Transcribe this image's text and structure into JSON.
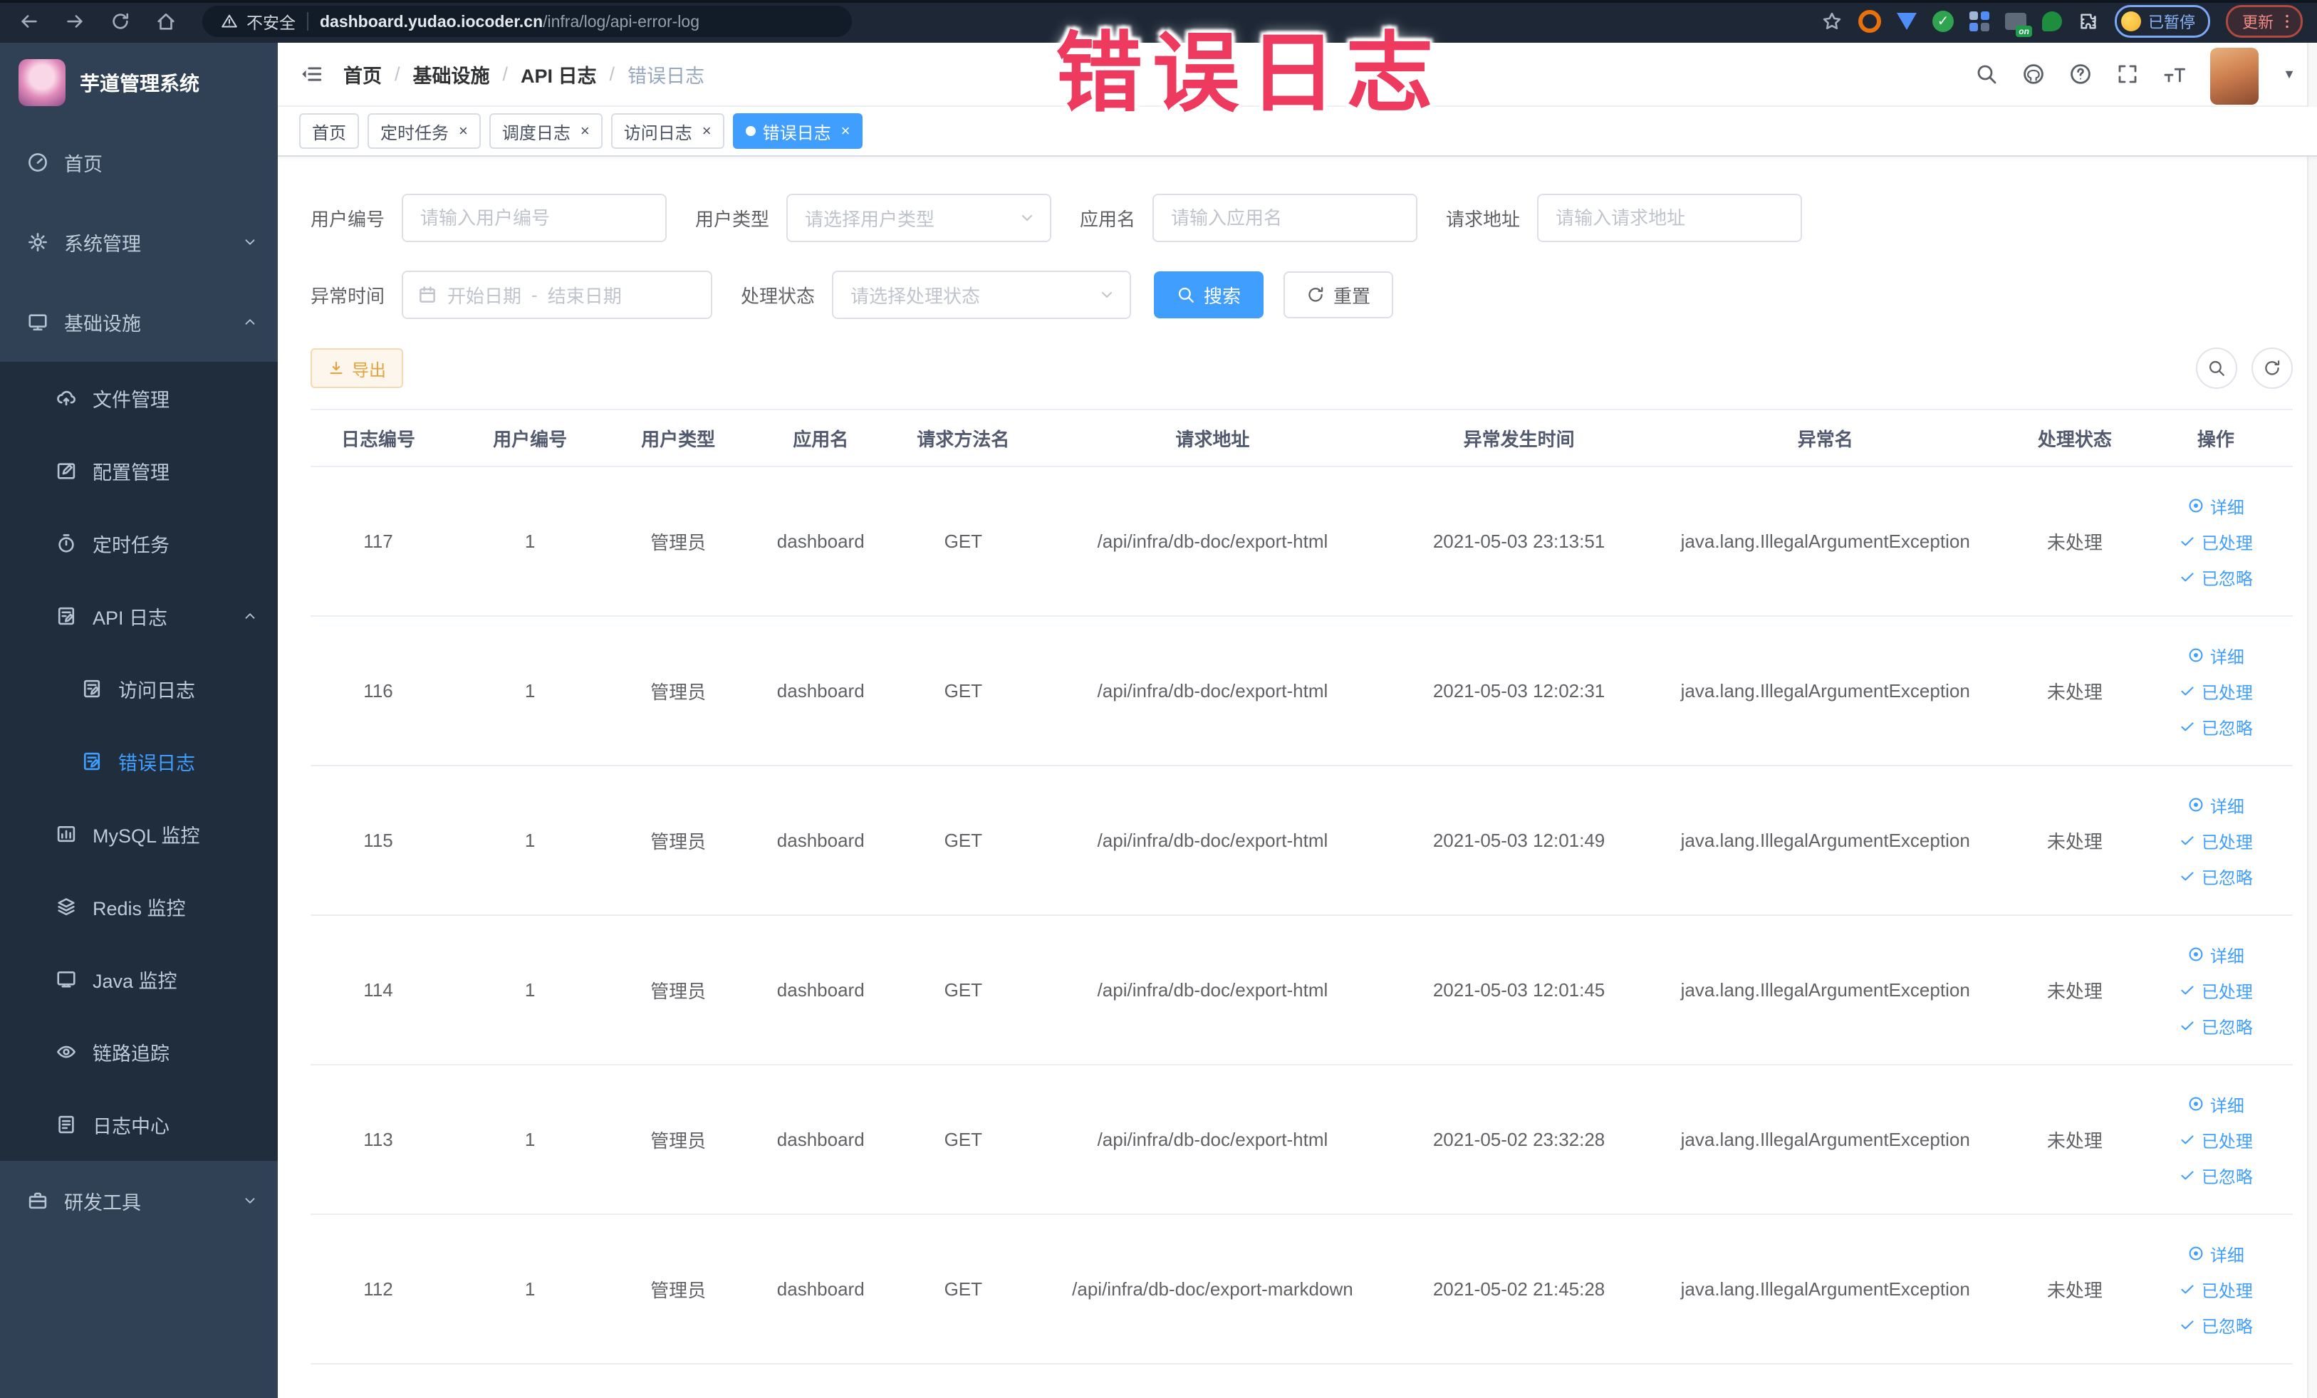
{
  "annotation": {
    "text": "错误日志",
    "color": "#ee3a5f"
  },
  "browser": {
    "security_label": "不安全",
    "url_domain": "dashboard.yudao.iocoder.cn",
    "url_path": "/infra/log/api-error-log",
    "extensions_paused_label": "已暂停",
    "update_label": "更新"
  },
  "sidebar": {
    "title": "芋道管理系统",
    "items": [
      {
        "label": "首页",
        "icon": "gauge",
        "level": 1
      },
      {
        "label": "系统管理",
        "icon": "gear",
        "level": 1,
        "chevron": "down"
      },
      {
        "label": "基础设施",
        "icon": "monitor",
        "level": 1,
        "chevron": "up"
      },
      {
        "label": "文件管理",
        "icon": "cloud",
        "level": 2,
        "sub": true
      },
      {
        "label": "配置管理",
        "icon": "edit",
        "level": 2,
        "sub": true
      },
      {
        "label": "定时任务",
        "icon": "timer",
        "level": 2,
        "sub": true
      },
      {
        "label": "API 日志",
        "icon": "docedit",
        "level": 2,
        "sub": true,
        "chevron": "up"
      },
      {
        "label": "访问日志",
        "icon": "docedit",
        "level": 3,
        "sub": true
      },
      {
        "label": "错误日志",
        "icon": "docedit",
        "level": 3,
        "sub": true,
        "active": true
      },
      {
        "label": "MySQL 监控",
        "icon": "chart",
        "level": 2,
        "sub": true
      },
      {
        "label": "Redis 监控",
        "icon": "layers",
        "level": 2,
        "sub": true
      },
      {
        "label": "Java 监控",
        "icon": "screen",
        "level": 2,
        "sub": true
      },
      {
        "label": "链路追踪",
        "icon": "eye",
        "level": 2,
        "sub": true
      },
      {
        "label": "日志中心",
        "icon": "doc",
        "level": 2,
        "sub": true
      },
      {
        "label": "研发工具",
        "icon": "briefcase",
        "level": 1,
        "chevron": "down"
      }
    ]
  },
  "navbar": {
    "breadcrumb": [
      "首页",
      "基础设施",
      "API 日志",
      "错误日志"
    ]
  },
  "tabs": [
    {
      "label": "首页",
      "closable": false,
      "active": false
    },
    {
      "label": "定时任务",
      "closable": true,
      "active": false
    },
    {
      "label": "调度日志",
      "closable": true,
      "active": false
    },
    {
      "label": "访问日志",
      "closable": true,
      "active": false
    },
    {
      "label": "错误日志",
      "closable": true,
      "active": true
    }
  ],
  "filters": {
    "user_id": {
      "label": "用户编号",
      "placeholder": "请输入用户编号"
    },
    "user_type": {
      "label": "用户类型",
      "placeholder": "请选择用户类型"
    },
    "app_name": {
      "label": "应用名",
      "placeholder": "请输入应用名"
    },
    "request_url": {
      "label": "请求地址",
      "placeholder": "请输入请求地址"
    },
    "exception_time": {
      "label": "异常时间",
      "start_placeholder": "开始日期",
      "separator": "-",
      "end_placeholder": "结束日期"
    },
    "process_status": {
      "label": "处理状态",
      "placeholder": "请选择处理状态"
    },
    "search_label": "搜索",
    "reset_label": "重置"
  },
  "toolbar": {
    "export_label": "导出"
  },
  "table": {
    "columns": [
      "日志编号",
      "用户编号",
      "用户类型",
      "应用名",
      "请求方法名",
      "请求地址",
      "异常发生时间",
      "异常名",
      "处理状态",
      "操作"
    ],
    "action_labels": [
      "详细",
      "已处理",
      "已忽略"
    ],
    "rows": [
      [
        "117",
        "1",
        "管理员",
        "dashboard",
        "GET",
        "/api/infra/db-doc/export-html",
        "2021-05-03 23:13:51",
        "java.lang.IllegalArgumentException",
        "未处理"
      ],
      [
        "116",
        "1",
        "管理员",
        "dashboard",
        "GET",
        "/api/infra/db-doc/export-html",
        "2021-05-03 12:02:31",
        "java.lang.IllegalArgumentException",
        "未处理"
      ],
      [
        "115",
        "1",
        "管理员",
        "dashboard",
        "GET",
        "/api/infra/db-doc/export-html",
        "2021-05-03 12:01:49",
        "java.lang.IllegalArgumentException",
        "未处理"
      ],
      [
        "114",
        "1",
        "管理员",
        "dashboard",
        "GET",
        "/api/infra/db-doc/export-html",
        "2021-05-03 12:01:45",
        "java.lang.IllegalArgumentException",
        "未处理"
      ],
      [
        "113",
        "1",
        "管理员",
        "dashboard",
        "GET",
        "/api/infra/db-doc/export-html",
        "2021-05-02 23:32:28",
        "java.lang.IllegalArgumentException",
        "未处理"
      ],
      [
        "112",
        "1",
        "管理员",
        "dashboard",
        "GET",
        "/api/infra/db-doc/export-markdown",
        "2021-05-02 21:45:28",
        "java.lang.IllegalArgumentException",
        "未处理"
      ]
    ]
  },
  "colors": {
    "accent": "#409eff",
    "sidebar_bg": "#304156",
    "submenu_bg": "#1f2d3d",
    "warning": "#e6a23c",
    "tag_active": "#409eff"
  }
}
